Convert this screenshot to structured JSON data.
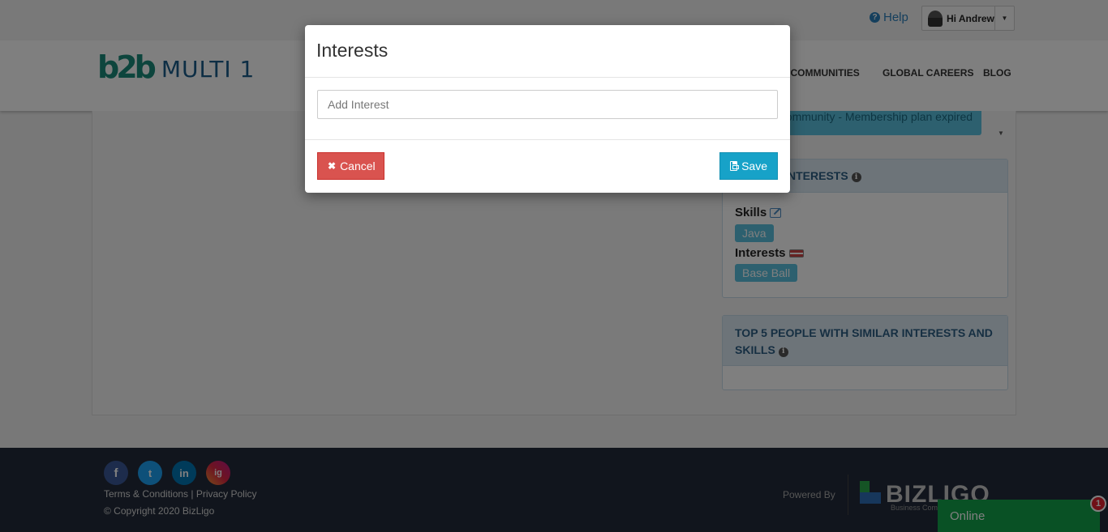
{
  "topbar": {
    "help_label": "Help",
    "user_greeting": "Hi Andrew"
  },
  "header": {
    "logo_mark": "b2b",
    "logo_text": "MULTI 1",
    "nav": [
      "L COMMUNITIES",
      "GLOBAL CAREERS",
      "BLOG"
    ]
  },
  "sidebar": {
    "membership_text": "c community - Membership plan expired",
    "interests_panel": {
      "title": "NTERESTS",
      "skills_label": "Skills",
      "skills": [
        "Java"
      ],
      "interests_label": "Interests",
      "interests": [
        "Base Ball"
      ]
    },
    "people_panel": {
      "title": "TOP 5 PEOPLE WITH SIMILAR INTERESTS AND SKILLS"
    }
  },
  "footer": {
    "social": [
      "f",
      "t",
      "in",
      "ig"
    ],
    "links": "Terms & Conditions | Privacy Policy",
    "copyright": "© Copyright 2020 BizLigo",
    "powered_by": "Powered By",
    "brand": "BIZLIGO",
    "brand_sub": "Business Com"
  },
  "chat": {
    "status": "Online",
    "badge_count": "1"
  },
  "modal": {
    "title": "Interests",
    "input_placeholder": "Add Interest",
    "input_value": "",
    "cancel_label": "Cancel",
    "save_label": "Save"
  },
  "colors": {
    "cancel": "#d9534f",
    "save": "#17a2c8",
    "tag": "#5bc0de",
    "online": "#13a24a",
    "footer": "#222b3a"
  }
}
